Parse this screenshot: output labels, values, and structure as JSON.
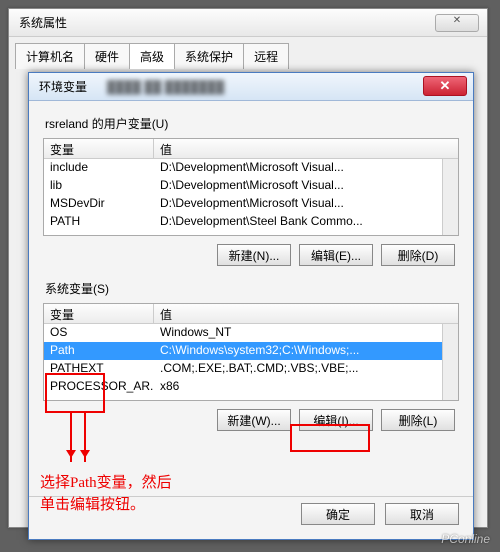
{
  "outer": {
    "title": "系统属性",
    "close": "✕",
    "tabs": [
      "计算机名",
      "硬件",
      "高级",
      "系统保护",
      "远程"
    ],
    "active_tab": 2
  },
  "env": {
    "title": "环境变量",
    "blurred": "████ ██ ███████",
    "close": "✕",
    "user_label": "rsreland 的用户变量(U)",
    "sys_label": "系统变量(S)",
    "col_var": "变量",
    "col_val": "值",
    "user_vars": [
      {
        "name": "include",
        "value": "D:\\Development\\Microsoft Visual..."
      },
      {
        "name": "lib",
        "value": "D:\\Development\\Microsoft Visual..."
      },
      {
        "name": "MSDevDir",
        "value": "D:\\Development\\Microsoft Visual..."
      },
      {
        "name": "PATH",
        "value": "D:\\Development\\Steel Bank Commo..."
      }
    ],
    "sys_vars": [
      {
        "name": "OS",
        "value": "Windows_NT",
        "selected": false
      },
      {
        "name": "Path",
        "value": "C:\\Windows\\system32;C:\\Windows;...",
        "selected": true
      },
      {
        "name": "PATHEXT",
        "value": ".COM;.EXE;.BAT;.CMD;.VBS;.VBE;...",
        "selected": false
      },
      {
        "name": "PROCESSOR_AR...",
        "value": "x86",
        "selected": false
      }
    ],
    "btn_new_u": "新建(N)...",
    "btn_edit_u": "编辑(E)...",
    "btn_del_u": "删除(D)",
    "btn_new_s": "新建(W)...",
    "btn_edit_s": "编辑(I)...",
    "btn_del_s": "删除(L)",
    "ok": "确定",
    "cancel": "取消"
  },
  "anno": {
    "line1": "选择Path变量，然后",
    "line2": "单击编辑按钮。"
  },
  "watermark": "PConline"
}
